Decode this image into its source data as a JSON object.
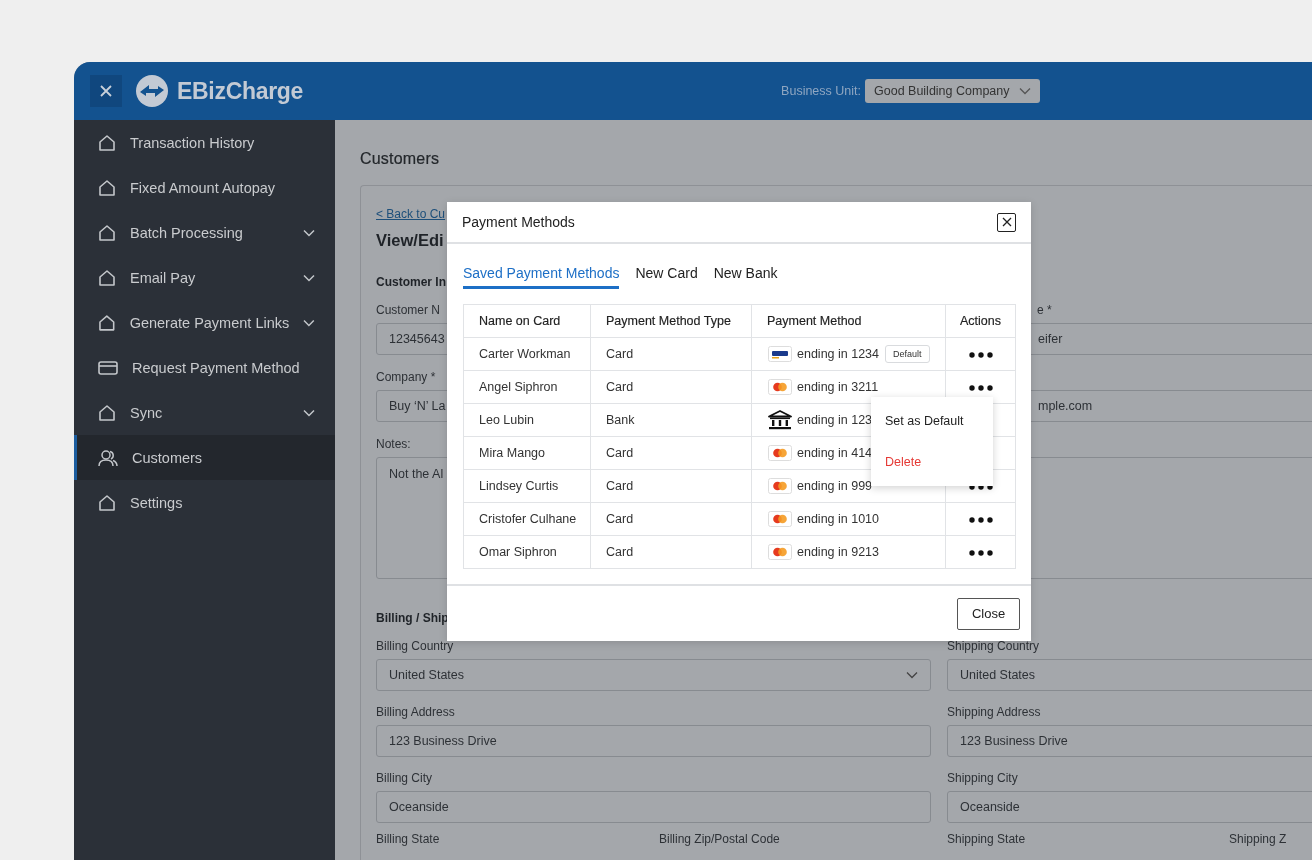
{
  "header": {
    "brand": "EBizCharge",
    "business_unit_label": "Business Unit:",
    "business_unit": "Good Building Company"
  },
  "sidebar": {
    "items": [
      {
        "label": "Transaction History",
        "kind": "home",
        "has_submenu": false,
        "selected": false
      },
      {
        "label": "Fixed Amount Autopay",
        "kind": "home",
        "has_submenu": false,
        "selected": false
      },
      {
        "label": "Batch Processing",
        "kind": "home",
        "has_submenu": true,
        "selected": false
      },
      {
        "label": "Email Pay",
        "kind": "home",
        "has_submenu": true,
        "selected": false
      },
      {
        "label": "Generate Payment Links",
        "kind": "home",
        "has_submenu": true,
        "selected": false
      },
      {
        "label": "Request Payment Method",
        "kind": "card",
        "has_submenu": false,
        "selected": false
      },
      {
        "label": "Sync",
        "kind": "home",
        "has_submenu": true,
        "selected": false
      },
      {
        "label": "Customers",
        "kind": "users",
        "has_submenu": false,
        "selected": true
      },
      {
        "label": "Settings",
        "kind": "home",
        "has_submenu": false,
        "selected": false
      }
    ]
  },
  "page": {
    "title": "Customers",
    "back_link": "< Back to Cu",
    "heading": "View/Edi",
    "section": "Customer In",
    "left_fields": [
      {
        "label": "Customer N",
        "value": "12345643",
        "kind": "input"
      },
      {
        "label": "Company *",
        "value": "Buy ‘N’ La",
        "kind": "input"
      },
      {
        "label": "Notes:",
        "value": "Not the Al",
        "kind": "textarea"
      }
    ],
    "right_fields": [
      {
        "label": "e *",
        "value": "eifer",
        "kind": "input"
      },
      {
        "value": "mple.com",
        "kind": "input"
      },
      {
        "kind": "textarea"
      }
    ],
    "billing_title": "Billing / Ship",
    "billing_rows": [
      [
        {
          "label": "Billing Country",
          "value": "United States",
          "kind": "select"
        },
        {
          "label": "Shipping Country",
          "value": "United States",
          "kind": "input"
        }
      ],
      [
        {
          "label": "Billing Address",
          "value": "123 Business Drive",
          "kind": "input"
        },
        {
          "label": "Shipping Address",
          "value": "123 Business Drive",
          "kind": "input"
        }
      ],
      [
        {
          "label": "Billing City",
          "value": "Oceanside",
          "kind": "input"
        },
        {
          "label": "Shipping City",
          "value": "Oceanside",
          "kind": "input"
        }
      ]
    ],
    "bottom_labels": [
      "Billing State",
      "Billing Zip/Postal Code",
      "Shipping State",
      "Shipping Z"
    ]
  },
  "modal": {
    "title": "Payment Methods",
    "tabs": [
      {
        "label": "Saved Payment Methods",
        "selected": true
      },
      {
        "label": "New Card",
        "selected": false
      },
      {
        "label": "New Bank",
        "selected": false
      }
    ],
    "columns": [
      "Name on Card",
      "Payment Method Type",
      "Payment Method",
      "Actions"
    ],
    "rows": [
      {
        "name": "Carter Workman",
        "type": "Card",
        "kind": "visa",
        "method": "ending in 1234",
        "badge": "Default"
      },
      {
        "name": "Angel Siphron",
        "type": "Card",
        "kind": "mastercard",
        "method": "ending in 3211",
        "menu": [
          {
            "label": "Set as Default",
            "kind": "normal"
          },
          {
            "label": "Delete",
            "kind": "danger"
          }
        ]
      },
      {
        "name": "Leo Lubin",
        "type": "Bank",
        "kind": "bank",
        "method": "ending in 123"
      },
      {
        "name": "Mira Mango",
        "type": "Card",
        "kind": "mastercard",
        "method": "ending in 414"
      },
      {
        "name": "Lindsey Curtis",
        "type": "Card",
        "kind": "mastercard",
        "method": "ending in 999"
      },
      {
        "name": "Cristofer Culhane",
        "type": "Card",
        "kind": "mastercard",
        "method": "ending in 1010"
      },
      {
        "name": "Omar Siphron",
        "type": "Card",
        "kind": "mastercard",
        "method": "ending in 9213"
      }
    ],
    "close_button": "Close"
  }
}
